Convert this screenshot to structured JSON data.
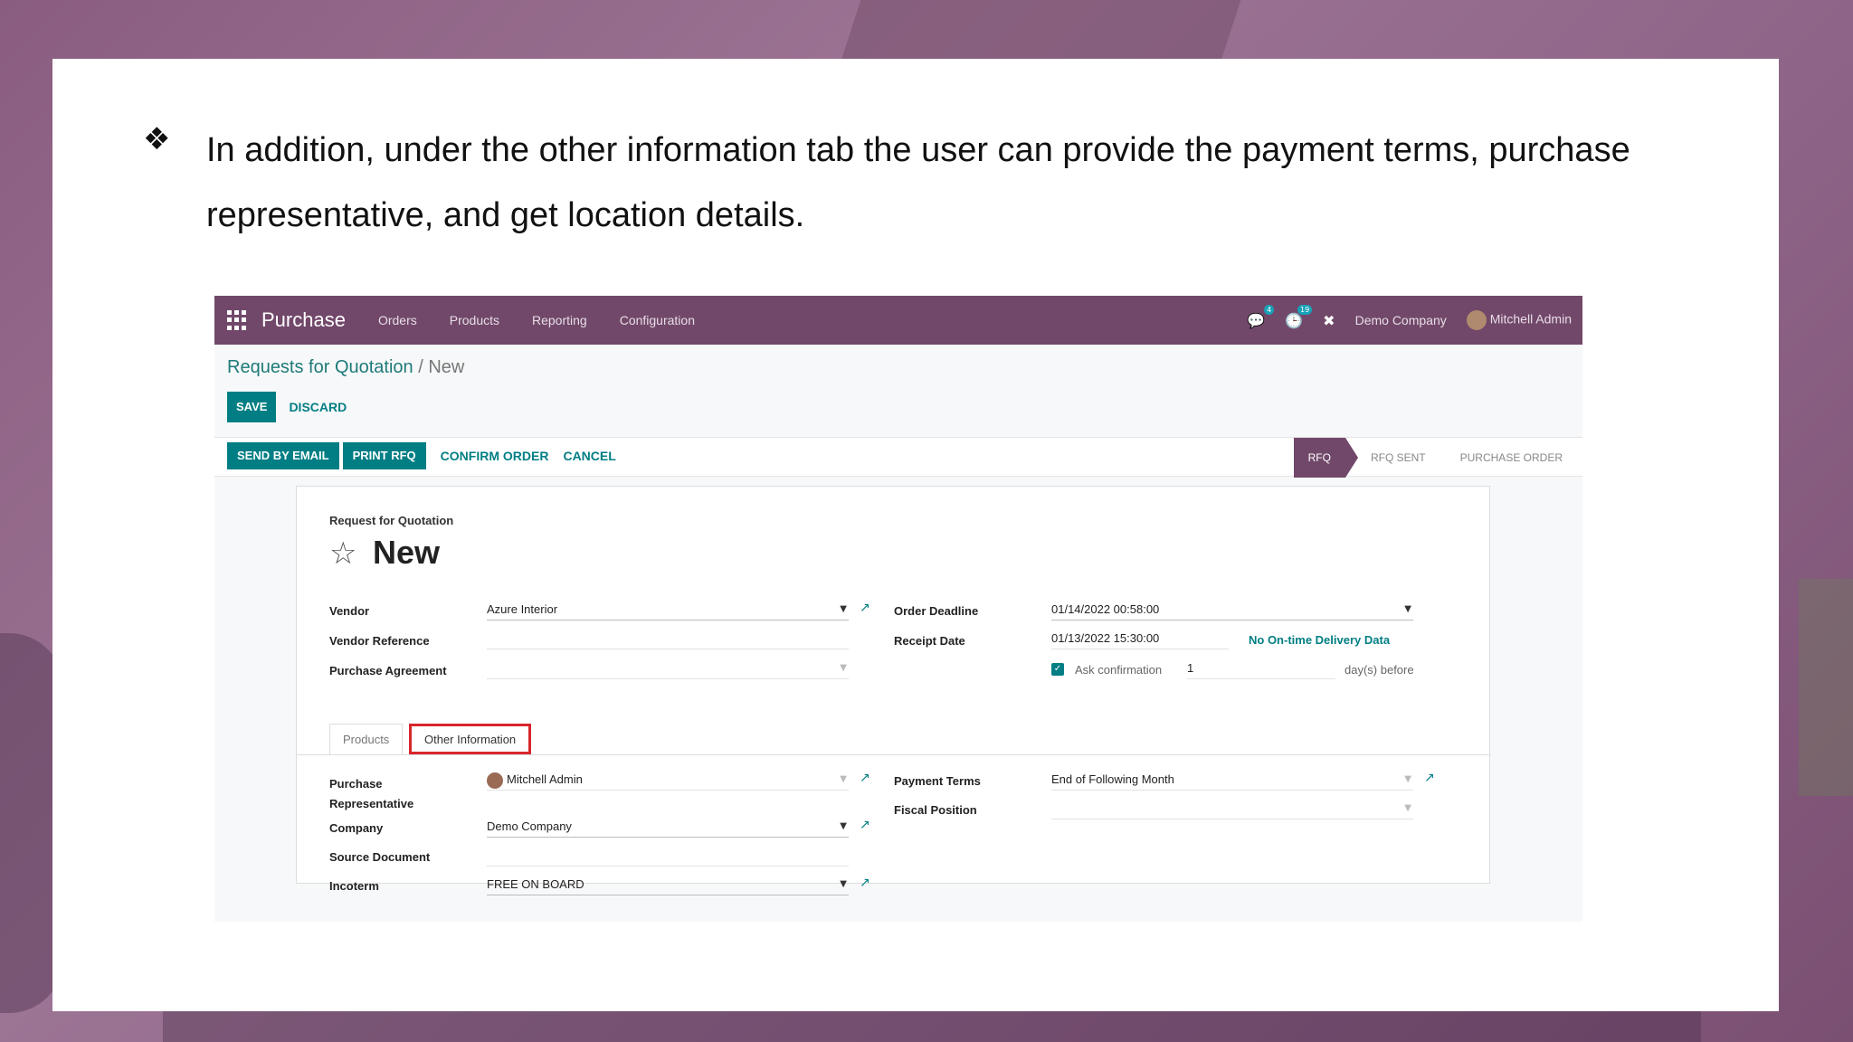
{
  "slide": {
    "bullet": "❖",
    "text": "In addition, under the other information tab the user can provide the payment terms, purchase representative, and get location details."
  },
  "topbar": {
    "app_name": "Purchase",
    "menu": [
      "Orders",
      "Products",
      "Reporting",
      "Configuration"
    ],
    "chat_badge": "4",
    "activity_badge": "19",
    "company": "Demo Company",
    "user": "Mitchell Admin"
  },
  "breadcrumb": {
    "parent": "Requests for Quotation",
    "separator": " / ",
    "current": "New"
  },
  "actions": {
    "save": "SAVE",
    "discard": "DISCARD"
  },
  "statusbar": {
    "send_email": "SEND BY EMAIL",
    "print_rfq": "PRINT RFQ",
    "confirm_order": "CONFIRM ORDER",
    "cancel": "CANCEL",
    "stages": [
      "RFQ",
      "RFQ SENT",
      "PURCHASE ORDER"
    ]
  },
  "form": {
    "subtitle": "Request for Quotation",
    "title": "New",
    "vendor_label": "Vendor",
    "vendor_value": "Azure Interior",
    "vendor_ref_label": "Vendor Reference",
    "purchase_agreement_label": "Purchase Agreement",
    "order_deadline_label": "Order Deadline",
    "order_deadline_value": "01/14/2022 00:58:00",
    "receipt_date_label": "Receipt Date",
    "receipt_date_value": "01/13/2022 15:30:00",
    "on_time_text": "No On-time Delivery Data",
    "ask_confirmation_label": "Ask confirmation",
    "ask_confirmation_days": "1",
    "days_before": "day(s) before"
  },
  "tabs": {
    "products": "Products",
    "other": "Other Information"
  },
  "other_info": {
    "purchase_rep_label": "Purchase Representative",
    "purchase_rep_value": "Mitchell Admin",
    "company_label": "Company",
    "company_value": "Demo Company",
    "source_doc_label": "Source Document",
    "incoterm_label": "Incoterm",
    "incoterm_value": "FREE ON BOARD",
    "payment_terms_label": "Payment Terms",
    "payment_terms_value": "End of Following Month",
    "fiscal_position_label": "Fiscal Position"
  },
  "colors": {
    "brand": "#71486a",
    "primary": "#017e84",
    "highlight": "#d8262c"
  }
}
